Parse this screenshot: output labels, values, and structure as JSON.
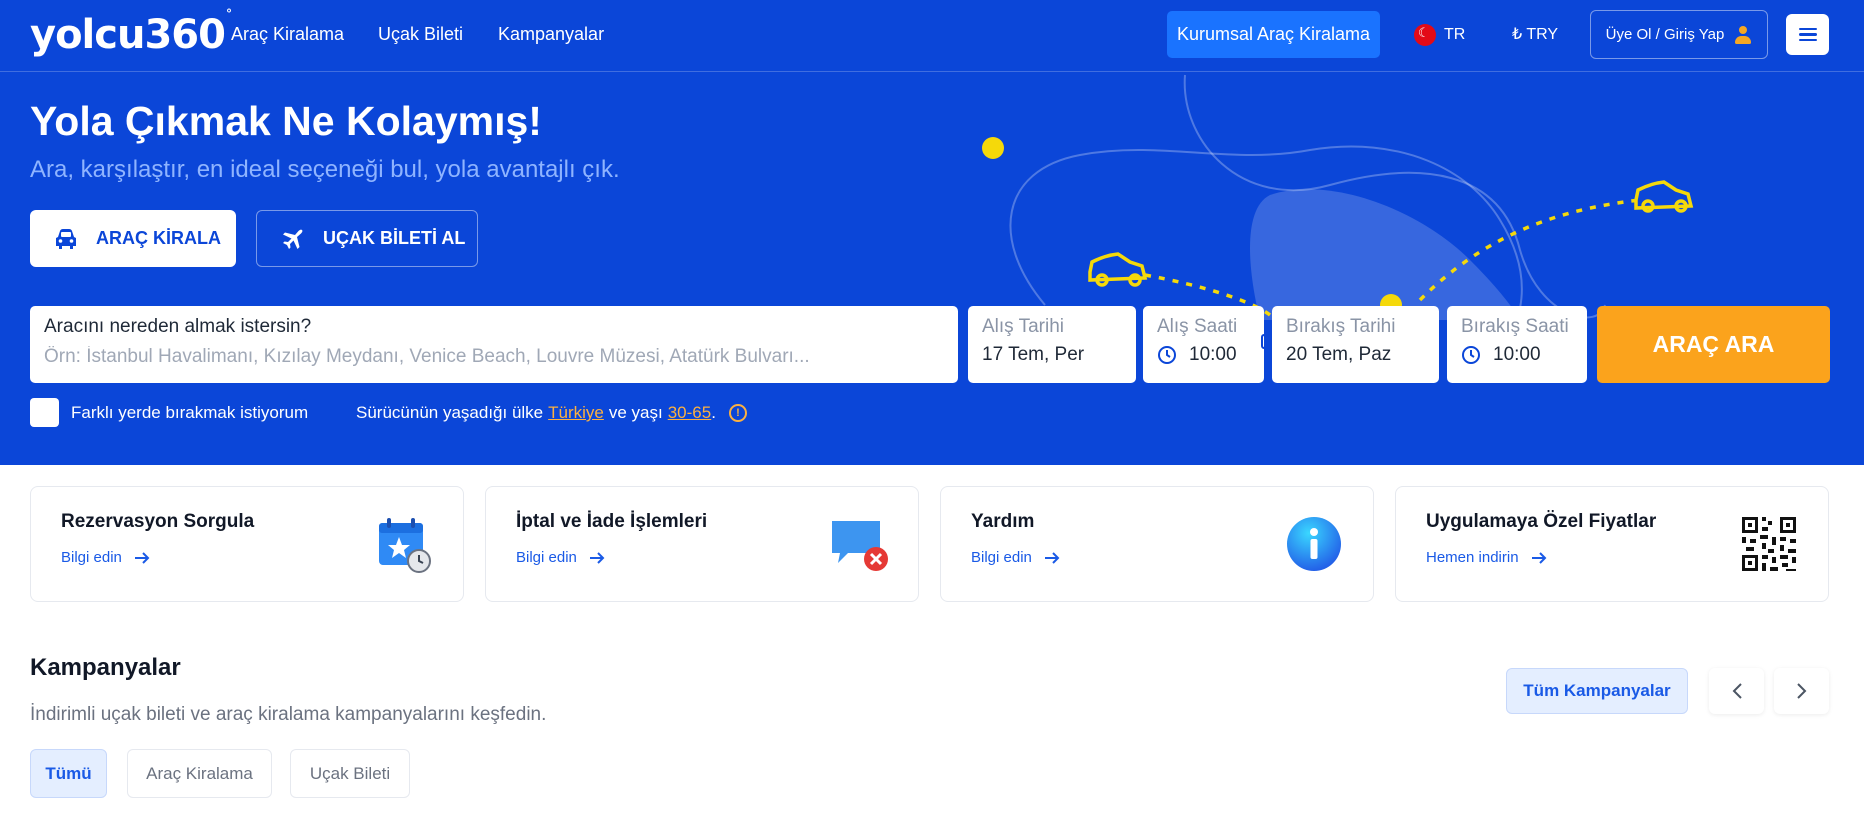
{
  "header": {
    "logo": "yolcu360",
    "logo_mark": "°",
    "nav_links": [
      "Araç Kiralama",
      "Uçak Bileti",
      "Kampanyalar"
    ],
    "corporate_button": "Kurumsal Araç Kiralama",
    "language": "TR",
    "currency": "₺ TRY",
    "login_button": "Üye Ol / Giriş Yap"
  },
  "hero": {
    "title": "Yola Çıkmak Ne Kolaymış!",
    "subtitle": "Ara, karşılaştır, en ideal seçeneği bul, yola avantajlı çık.",
    "tabs": [
      {
        "label": "ARAÇ KİRALA",
        "icon": "car-icon",
        "active": true
      },
      {
        "label": "UÇAK BİLETİ AL",
        "icon": "airplane-icon",
        "active": false
      }
    ]
  },
  "search": {
    "location_label": "Aracını nereden almak istersin?",
    "location_placeholder": "Örn: İstanbul Havalimanı, Kızılay Meydanı, Venice Beach, Louvre Müzesi, Atatürk Bulvarı...",
    "pickup_date_label": "Alış Tarihi",
    "pickup_date_value": "17 Tem, Per",
    "pickup_time_label": "Alış Saati",
    "pickup_time_value": "10:00",
    "dropoff_date_label": "Bırakış Tarihi",
    "dropoff_date_value": "20 Tem, Paz",
    "dropoff_time_label": "Bırakış Saati",
    "dropoff_time_value": "10:00",
    "search_button": "ARAÇ ARA",
    "different_return_label": "Farklı yerde bırakmak istiyorum",
    "driver_text_1": "Sürücünün yaşadığı ülke",
    "driver_country": "Türkiye",
    "driver_text_2": "ve yaşı",
    "driver_age": "30-65",
    "driver_text_3": "."
  },
  "cards": [
    {
      "title": "Rezervasyon Sorgula",
      "link": "Bilgi edin",
      "icon": "calendar-clock-icon"
    },
    {
      "title": "İptal ve İade İşlemleri",
      "link": "Bilgi edin",
      "icon": "chat-cancel-icon"
    },
    {
      "title": "Yardım",
      "link": "Bilgi edin",
      "icon": "info-icon"
    },
    {
      "title": "Uygulamaya Özel Fiyatlar",
      "link": "Hemen indirin",
      "icon": "qr-code-icon"
    }
  ],
  "campaigns": {
    "title": "Kampanyalar",
    "subtitle": "İndirimli uçak bileti ve araç kiralama kampanyalarını keşfedin.",
    "all_button": "Tüm Kampanyalar",
    "filters": [
      "Tümü",
      "Araç Kiralama",
      "Uçak Bileti"
    ],
    "active_filter": "Tümü"
  },
  "colors": {
    "primary": "#0b46d8",
    "accent": "#fba31c",
    "link": "#1a5ae6",
    "highlight": "#1a73ff"
  }
}
